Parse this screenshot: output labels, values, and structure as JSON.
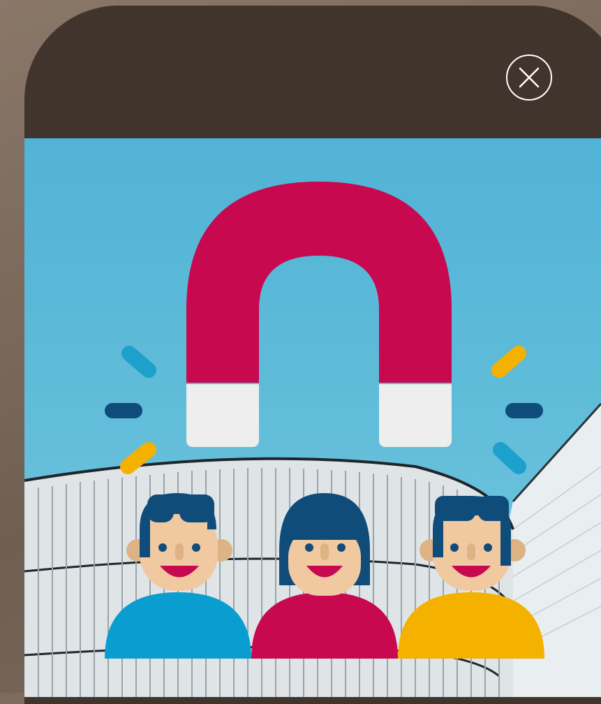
{
  "modal": {
    "close_icon": "close-icon",
    "colors": {
      "backdrop": "#7d6b5e",
      "header": "#40342c",
      "sky": "#5fbcd9",
      "magnet": "#c8084f",
      "magnet_tips": "#eeeeee",
      "person_left_shirt": "#0a9ed0",
      "person_middle_shirt": "#c8084f",
      "person_right_shirt": "#f5b100",
      "hair": "#0f4c7a",
      "skin": "#f1c9a0"
    },
    "illustration": {
      "icons": [
        "magnet-icon",
        "people-group-icon",
        "building-photo"
      ]
    }
  }
}
